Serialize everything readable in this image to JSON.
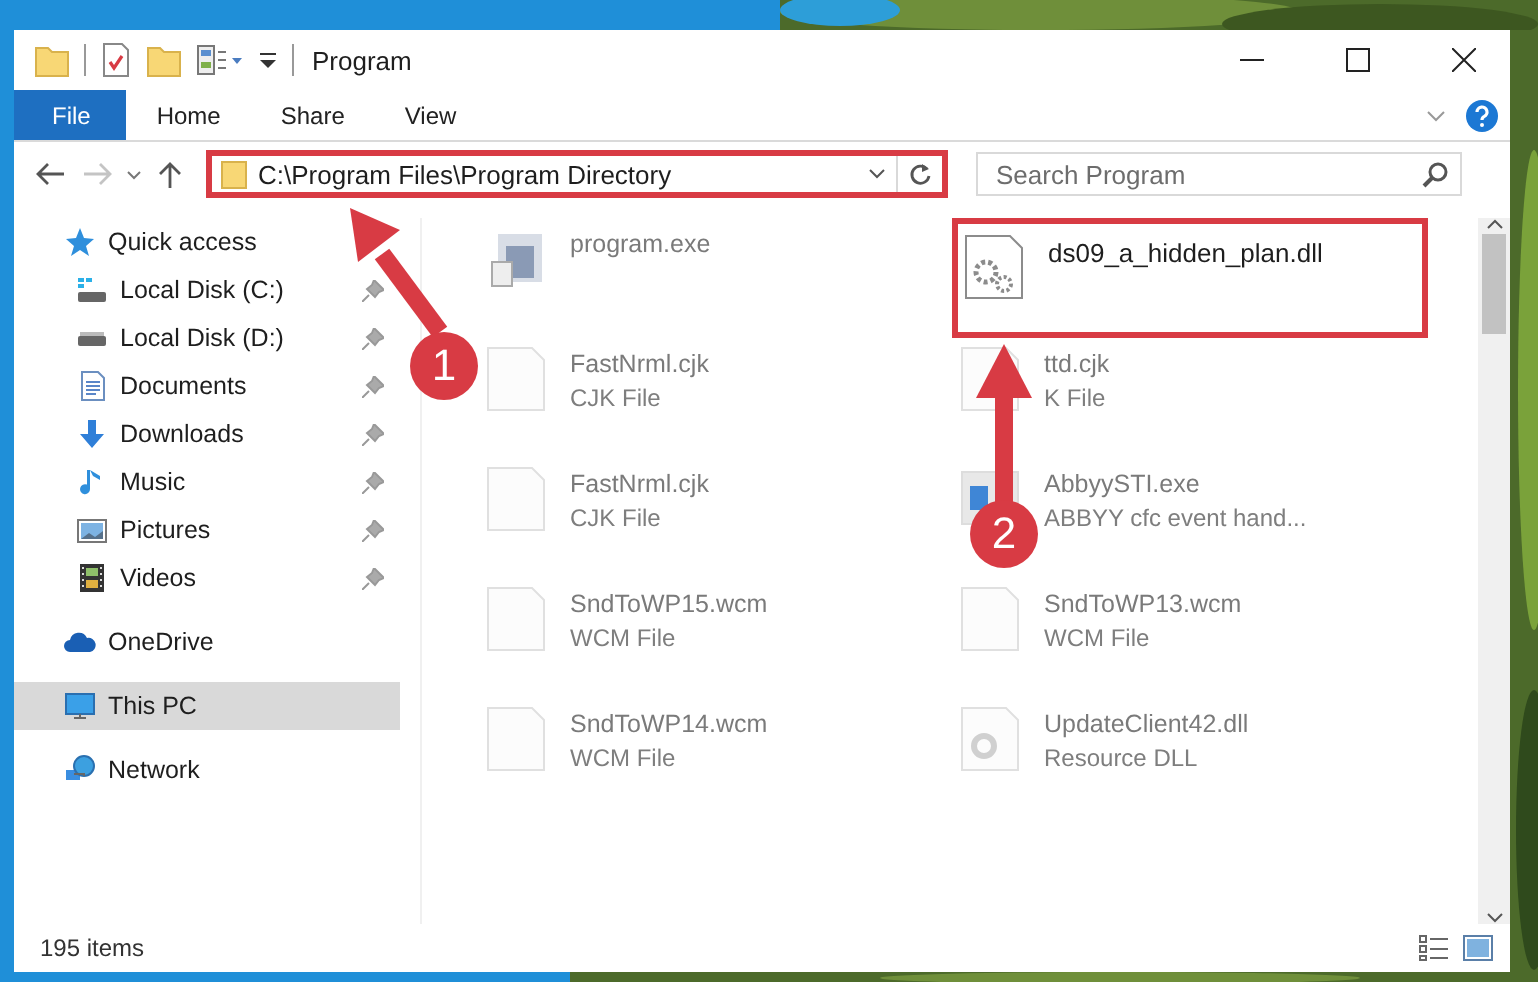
{
  "window": {
    "title": "Program"
  },
  "ribbon": {
    "tabs": [
      {
        "label": "File",
        "kind": "file"
      },
      {
        "label": "Home",
        "kind": "tab"
      },
      {
        "label": "Share",
        "kind": "tab"
      },
      {
        "label": "View",
        "kind": "tab"
      }
    ]
  },
  "address_bar": {
    "path": "C:\\Program Files\\Program Directory",
    "highlighted": true
  },
  "search": {
    "placeholder": "Search Program"
  },
  "sidebar": {
    "items": [
      {
        "label": "Quick access",
        "kind": "star",
        "selected": false,
        "children": [
          {
            "label": "Local Disk (C:)",
            "kind": "disk-c",
            "pinned": true,
            "selected": false
          },
          {
            "label": "Local Disk (D:)",
            "kind": "disk",
            "pinned": true,
            "selected": false
          },
          {
            "label": "Documents",
            "kind": "documents",
            "pinned": true,
            "selected": false
          },
          {
            "label": "Downloads",
            "kind": "downloads",
            "pinned": true,
            "selected": false
          },
          {
            "label": "Music",
            "kind": "music",
            "pinned": true,
            "selected": false
          },
          {
            "label": "Pictures",
            "kind": "pictures",
            "pinned": true,
            "selected": false
          },
          {
            "label": "Videos",
            "kind": "videos",
            "pinned": true,
            "selected": false
          }
        ]
      },
      {
        "label": "OneDrive",
        "kind": "cloud",
        "selected": false
      },
      {
        "label": "This PC",
        "kind": "pc",
        "selected": true
      },
      {
        "label": "Network",
        "kind": "network",
        "selected": false
      }
    ]
  },
  "files": [
    {
      "name": "program.exe",
      "kind": "exe",
      "highlighted": false
    },
    {
      "name": "ds09_a_hidden_plan.dll",
      "kind": "dll",
      "highlighted": true
    },
    {
      "name": "FastNrml.cjk",
      "type": "CJK File",
      "kind": "blank",
      "highlighted": false
    },
    {
      "name": "ttd.cjk",
      "type": "K File",
      "kind": "blank",
      "highlighted": false
    },
    {
      "name": "FastNrml.cjk",
      "type": "CJK File",
      "kind": "blank",
      "highlighted": false
    },
    {
      "name": "AbbyySTI.exe",
      "type": "ABBYY cfc event hand...",
      "kind": "app",
      "highlighted": false
    },
    {
      "name": "SndToWP15.wcm",
      "type": "WCM File",
      "kind": "blank",
      "highlighted": false
    },
    {
      "name": "SndToWP13.wcm",
      "type": "WCM File",
      "kind": "blank",
      "highlighted": false
    },
    {
      "name": "SndToWP14.wcm",
      "type": "WCM File",
      "kind": "blank",
      "highlighted": false
    },
    {
      "name": "UpdateClient42.dll",
      "type": "Resource DLL",
      "kind": "gear",
      "highlighted": false
    }
  ],
  "status_bar": {
    "item_count": "195 items"
  },
  "annotations": [
    {
      "label": "1"
    },
    {
      "label": "2"
    }
  ]
}
